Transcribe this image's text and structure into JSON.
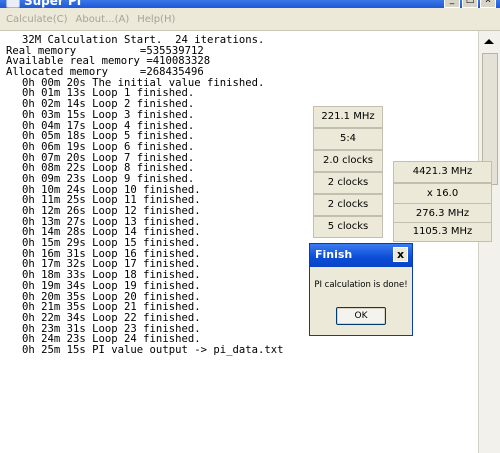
{
  "window": {
    "title": "Super PI",
    "controls": [
      "_",
      "□",
      "x"
    ]
  },
  "menu": {
    "items": [
      "Calculate(C)",
      "About...(A)",
      "Help(H)"
    ]
  },
  "output": {
    "header": [
      "32M Calculation Start.  24 iterations.",
      "Real memory          =535539712",
      "Available real memory =410083328",
      "Allocated memory     =268435496"
    ],
    "log": [
      "0h 00m 20s The initial value finished.",
      "0h 01m 13s Loop 1 finished.",
      "0h 02m 14s Loop 2 finished.",
      "0h 03m 15s Loop 3 finished.",
      "0h 04m 17s Loop 4 finished.",
      "0h 05m 18s Loop 5 finished.",
      "0h 06m 19s Loop 6 finished.",
      "0h 07m 20s Loop 7 finished.",
      "0h 08m 22s Loop 8 finished.",
      "0h 09m 23s Loop 9 finished.",
      "0h 10m 24s Loop 10 finished.",
      "0h 11m 25s Loop 11 finished.",
      "0h 12m 26s Loop 12 finished.",
      "0h 13m 27s Loop 13 finished.",
      "0h 14m 28s Loop 14 finished.",
      "0h 15m 29s Loop 15 finished.",
      "0h 16m 31s Loop 16 finished.",
      "0h 17m 32s Loop 17 finished.",
      "0h 18m 33s Loop 18 finished.",
      "0h 19m 34s Loop 19 finished.",
      "0h 20m 35s Loop 20 finished.",
      "0h 21m 35s Loop 21 finished.",
      "0h 22m 34s Loop 22 finished.",
      "0h 23m 31s Loop 23 finished.",
      "0h 24m 23s Loop 24 finished.",
      "0h 25m 15s PI value output -> pi_data.txt"
    ]
  },
  "monitor": {
    "left": [
      "221.1 MHz",
      "5:4",
      "2.0 clocks",
      "2 clocks",
      "2 clocks",
      "5 clocks"
    ],
    "right": [
      "4421.3 MHz",
      "x 16.0",
      "276.3 MHz",
      "1105.3 MHz"
    ]
  },
  "dialog": {
    "title": "Finish",
    "close": "x",
    "message": "PI calculation is done!",
    "ok_label": "OK"
  },
  "colors": {
    "titlebar": "#1f57d6",
    "menubar": "#ece9d8",
    "menu_text_disabled": "#a6a29a",
    "dialog_titlebar": "#0b4cd8"
  }
}
